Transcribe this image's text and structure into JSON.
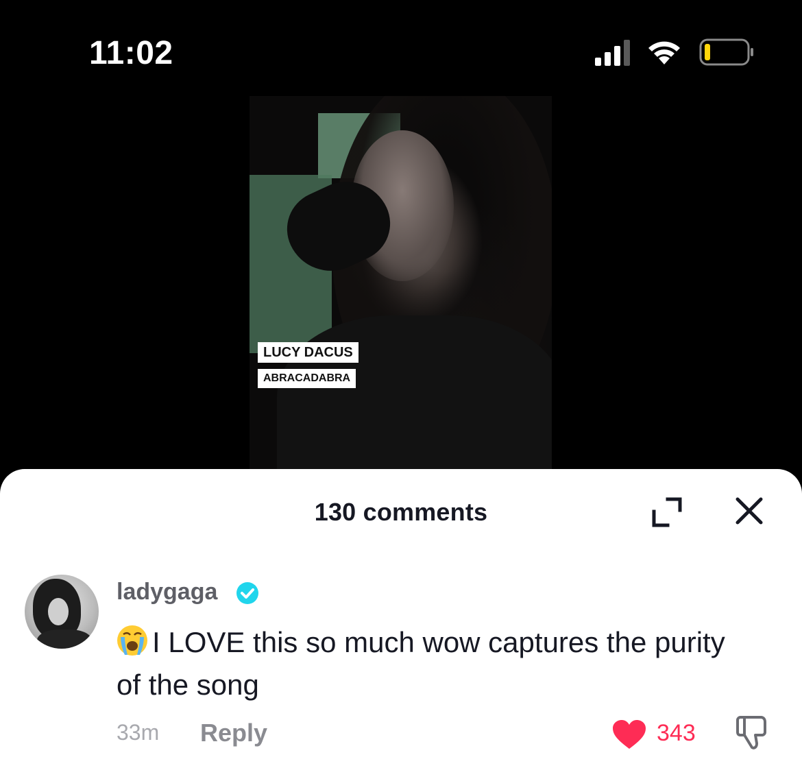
{
  "status_bar": {
    "time": "11:02"
  },
  "video": {
    "overlay_artist": "LUCY DACUS",
    "overlay_song": "ABRACADABRA"
  },
  "comments_sheet": {
    "title": "130 comments",
    "comment": {
      "username": "ladygaga",
      "text": "I LOVE this so much wow captures the purity of the song",
      "timestamp": "33m",
      "reply_label": "Reply",
      "like_count": "343"
    }
  },
  "colors": {
    "like_red": "#fe2c55",
    "verified_blue": "#20d5ec",
    "text_primary": "#161823"
  },
  "icons": [
    "signal-icon",
    "wifi-icon",
    "battery-icon",
    "expand-icon",
    "close-icon",
    "verified-badge-icon",
    "crying-face-emoji",
    "heart-icon",
    "dislike-icon"
  ]
}
